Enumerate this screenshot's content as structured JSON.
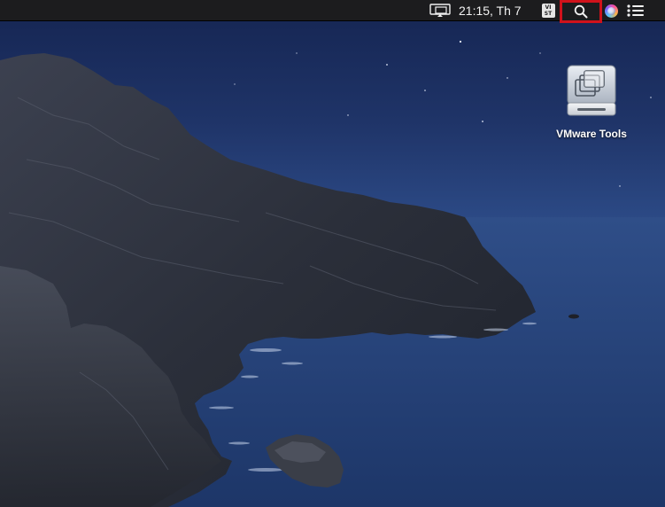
{
  "menubar": {
    "display_icon": "display-mirroring-icon",
    "clock": "21:15, Th 7",
    "input_source": {
      "line1": "VI",
      "line2": "ST"
    },
    "spotlight_icon": "magnifying-glass-icon",
    "siri_icon": "siri-icon",
    "notification_icon": "notification-center-icon",
    "highlight_color": "#d0121b"
  },
  "desktop": {
    "wallpaper": "macOS Catalina coastline at night",
    "icons": [
      {
        "label": "VMware Tools",
        "icon": "disk-image-icon"
      }
    ]
  }
}
